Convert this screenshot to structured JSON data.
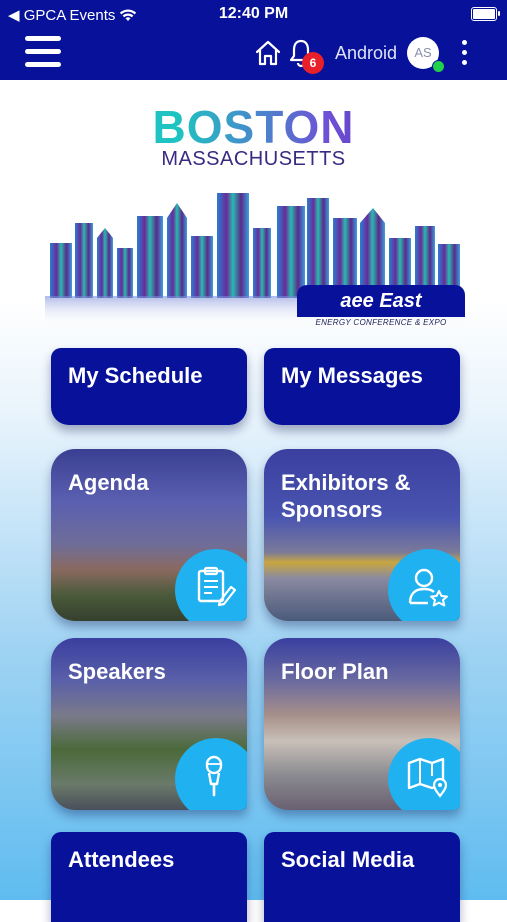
{
  "status_bar": {
    "back_app": "◀ GPCA Events",
    "time": "12:40 PM"
  },
  "nav": {
    "notification_count": "6",
    "username": "Android",
    "avatar_initials": "AS"
  },
  "banner": {
    "city": "BOSTON",
    "state": "MASSACHUSETTS",
    "event_logo": "aee East",
    "event_tagline": "ENERGY CONFERENCE & EXPO"
  },
  "tiles": {
    "my_schedule": "My Schedule",
    "my_messages": "My Messages",
    "agenda": "Agenda",
    "exhibitors_line1": "Exhibitors &",
    "exhibitors_line2": "Sponsors",
    "speakers": "Speakers",
    "floor_plan": "Floor Plan",
    "attendees": "Attendees",
    "social_media": "Social Media"
  },
  "colors": {
    "brand_navy": "#07119a",
    "accent_cyan": "#1fb1f0",
    "badge_red": "#e8202a",
    "online_green": "#22d14a"
  }
}
